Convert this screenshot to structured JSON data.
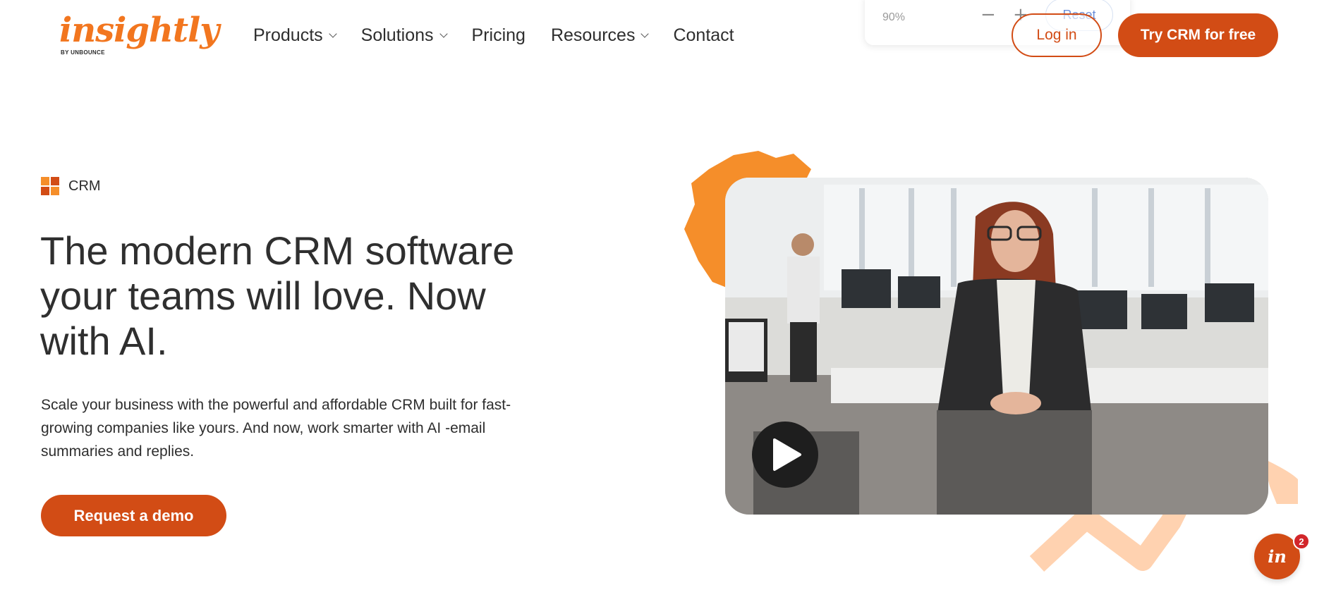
{
  "header": {
    "logo": {
      "wordmark": "insightly",
      "byline": "BY UNBOUNCE"
    },
    "nav": [
      {
        "label": "Products",
        "has_dropdown": true,
        "icon": "chevron-down-icon"
      },
      {
        "label": "Solutions",
        "has_dropdown": true,
        "icon": "chevron-down-icon"
      },
      {
        "label": "Pricing",
        "has_dropdown": false
      },
      {
        "label": "Resources",
        "has_dropdown": true,
        "icon": "chevron-down-icon"
      },
      {
        "label": "Contact",
        "has_dropdown": false
      }
    ],
    "login_label": "Log in",
    "cta_label": "Try CRM for free"
  },
  "zoom": {
    "level": "90%",
    "minus": "−",
    "plus": "+",
    "reset_label": "Reset"
  },
  "hero": {
    "tag_label": "CRM",
    "tag_icon": "crm-grid-icon",
    "title": "The modern CRM software your teams will love. Now with AI.",
    "subtitle": "Scale your business with the powerful and affordable CRM built for fast-growing companies like yours. And now, work smarter with AI -email summaries and replies.",
    "demo_label": "Request a demo",
    "video": {
      "icon": "play-icon"
    }
  },
  "chat": {
    "icon": "insightly-chat-icon",
    "glyph": "in",
    "badge_count": "2"
  },
  "colors": {
    "brand_orange": "#f2761f",
    "cta_orange": "#d24c15",
    "peach": "#ffd2b0",
    "text": "#2f2f2f",
    "badge_red": "#d2262a"
  }
}
